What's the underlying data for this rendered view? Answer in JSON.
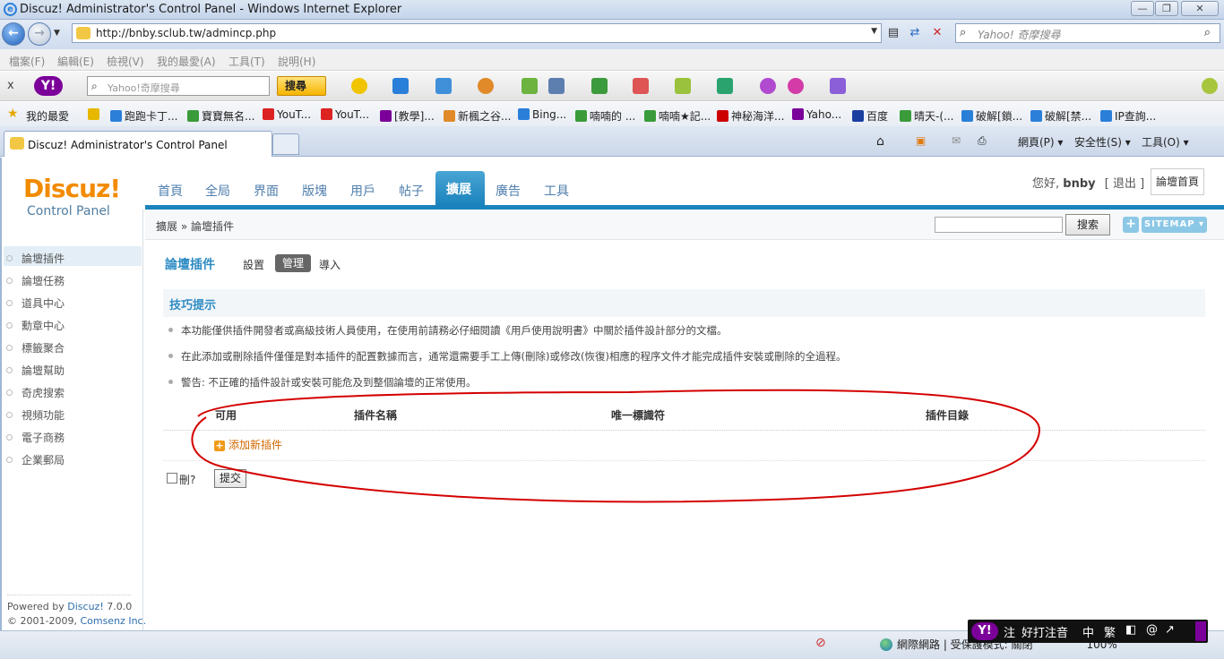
{
  "window": {
    "title": "Discuz! Administrator's Control Panel - Windows Internet Explorer",
    "minimize": "—",
    "maximize": "❐",
    "close": "✕"
  },
  "address": {
    "url": "http://bnby.sclub.tw/admincp.php",
    "search_placeholder": "Yahoo! 奇摩搜尋"
  },
  "menu": [
    "檔案(F)",
    "編輯(E)",
    "檢視(V)",
    "我的最愛(A)",
    "工具(T)",
    "說明(H)"
  ],
  "yahoo_toolbar": {
    "close": "x",
    "logo": "Y!",
    "search_placeholder": "Yahoo!奇摩搜尋",
    "search_button": "搜尋"
  },
  "favorites": {
    "label": "我的最愛",
    "items": [
      "跑跑卡丁...",
      "寶寶無名...",
      "YouT...",
      "YouT...",
      "[教學]...",
      "新楓之谷...",
      "Bing...",
      "喃喃的 ...",
      "喃喃★記...",
      "神秘海洋...",
      "Yaho...",
      "百度",
      "晴天-(...",
      "破解[鎖...",
      "破解[禁...",
      "IP查詢..."
    ]
  },
  "tabs": {
    "active_title": "Discuz! Administrator's Control Panel",
    "commands": [
      "網頁(P) ▾",
      "安全性(S) ▾",
      "工具(O) ▾"
    ]
  },
  "admin": {
    "logo": "Discuz!",
    "logo_sub": "Control Panel",
    "nav": [
      "首頁",
      "全局",
      "界面",
      "版塊",
      "用戶",
      "帖子",
      "擴展",
      "廣告",
      "工具"
    ],
    "nav_active": "擴展",
    "greeting_prefix": "您好,",
    "username": "bnby",
    "logout": "[ 退出 ]",
    "forum_home": "論壇首頁",
    "breadcrumb": "擴展 » 論壇插件",
    "search_button": "搜索",
    "plus": "+",
    "sitemap": "SITEMAP ▾"
  },
  "sidebar": {
    "items": [
      "論壇插件",
      "論壇任務",
      "道具中心",
      "勳章中心",
      "標籤聚合",
      "論壇幫助",
      "奇虎搜索",
      "視頻功能",
      "電子商務",
      "企業郵局"
    ],
    "powered_prefix": "Powered by ",
    "powered_brand": "Discuz!",
    "powered_version": " 7.0.0",
    "copyright_prefix": "© 2001-2009, ",
    "copyright_company": "Comsenz Inc."
  },
  "content": {
    "title": "論壇插件",
    "subtabs": [
      "設置",
      "管理",
      "導入"
    ],
    "subtab_active": "管理",
    "tips_title": "技巧提示",
    "tips": [
      "本功能僅供插件開發者或高級技術人員使用，在使用前請務必仔細閱讀《用戶使用說明書》中關於插件設計部分的文檔。",
      "在此添加或刪除插件僅僅是對本插件的配置數據而言，通常還需要手工上傳(刪除)或修改(恢復)相應的程序文件才能完成插件安裝或刪除的全過程。",
      "警告: 不正確的插件設計或安裝可能危及到整個論壇的正常使用。"
    ],
    "table_headers": [
      "可用",
      "插件名稱",
      "唯一標識符",
      "插件目錄"
    ],
    "add_plugin": "添加新插件",
    "delete_label": "刪?",
    "submit": "提交"
  },
  "statusbar": {
    "zone": "網際網路 | 受保護模式: 關閉",
    "zoom": "100%"
  },
  "ime": {
    "logo": "Y!",
    "items": [
      "注",
      "好打注音",
      "中",
      "繁",
      "◧",
      "@",
      "↗"
    ]
  },
  "colors": {
    "accent": "#1a83bd",
    "logo_orange": "#f28b00",
    "annotation_red": "#d40000"
  }
}
